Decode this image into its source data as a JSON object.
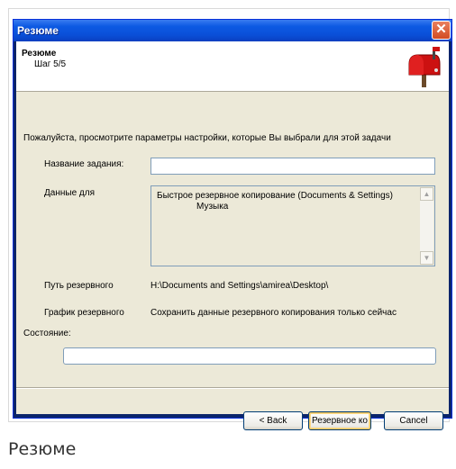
{
  "window": {
    "title": "Резюме",
    "close_glyph": "✕"
  },
  "header": {
    "title": "Резюме",
    "step": "Шаг 5/5",
    "icon": "mailbox-icon"
  },
  "body": {
    "intro": "Пожалуйста, просмотрите параметры настройки, которые Вы выбрали для этой задачи",
    "job_name_label": "Название задания:",
    "job_name_value": "",
    "data_for_label": "Данные для",
    "data_for_items": [
      "Быстрое резервное копирование (Documents & Settings)",
      "Музыка"
    ],
    "backup_path_label": "Путь резервного",
    "backup_path_value": "H:\\Documents and Settings\\amirea\\Desktop\\",
    "schedule_label": "График резервного",
    "schedule_value": "Сохранить данные резервного копирования только сейчас",
    "state_label": "Состояние:",
    "state_value": ""
  },
  "buttons": {
    "back": "< Back",
    "backup": "Резервное ко",
    "cancel": "Cancel"
  },
  "caption": "Резюме",
  "colors": {
    "titlebar": "#0a4fd8",
    "dialog_bg": "#ece9d8",
    "close_button": "#d24b23"
  }
}
